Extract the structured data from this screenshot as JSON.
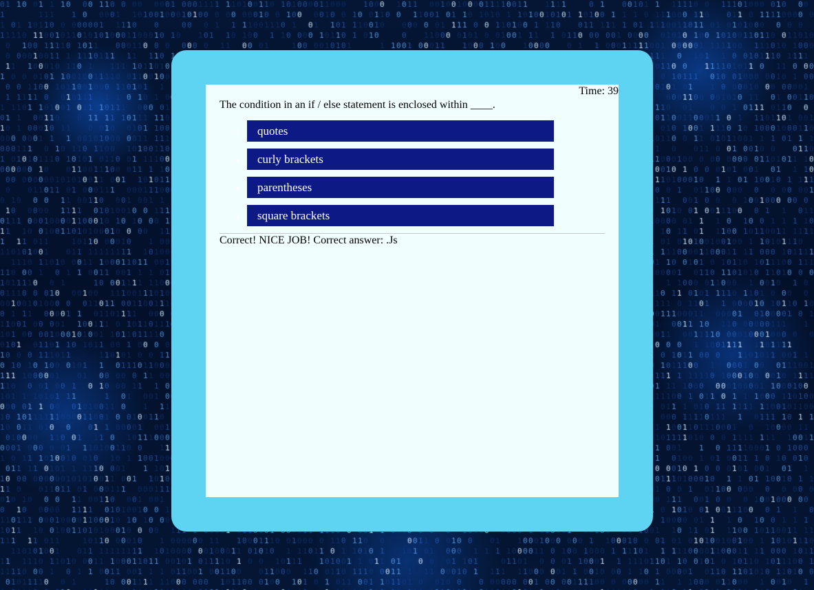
{
  "quiz": {
    "timer_label": "Time: 39",
    "question": "The condition in an if / else statement is enclosed within ____.",
    "choices": [
      {
        "label": "quotes"
      },
      {
        "label": "curly brackets"
      },
      {
        "label": "parentheses"
      },
      {
        "label": "square brackets"
      }
    ],
    "feedback": "Correct! NICE JOB! Correct answer: .Js"
  },
  "colors": {
    "background": "#020a1c",
    "frame": "#5fd4f2",
    "card": "#f0fffe",
    "choice_button": "#0d1a86",
    "choice_text": "#ffffff",
    "binary_glow": "#2b8cff"
  },
  "background": {
    "pattern": "binary-digits-code-rain"
  }
}
